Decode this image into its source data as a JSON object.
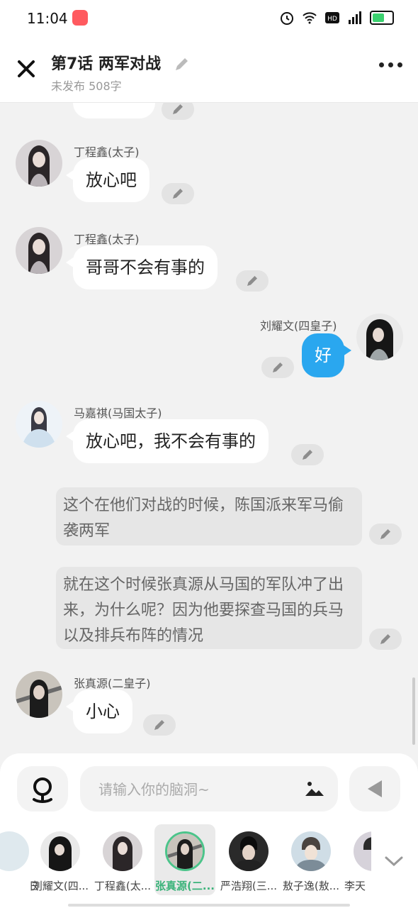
{
  "status_bar": {
    "time": "11:04"
  },
  "header": {
    "title": "第7话  两军对战",
    "subtitle": "未发布 508字"
  },
  "messages": [
    {
      "type": "left",
      "name": "丁程鑫(太子)",
      "text": "放心吧"
    },
    {
      "type": "left",
      "name": "丁程鑫(太子)",
      "text": "哥哥不会有事的"
    },
    {
      "type": "right",
      "name": "刘耀文(四皇子)",
      "text": "好"
    },
    {
      "type": "left",
      "name": "马嘉祺(马国太子)",
      "text": "放心吧，我不会有事的"
    },
    {
      "type": "narration",
      "text": "这个在他们对战的时候，陈国派来军马偷袭两军"
    },
    {
      "type": "narration",
      "text": "就在这个时候张真源从马国的军队冲了出来，为什么呢？因为他要探查马国的兵马以及排兵布阵的情况"
    },
    {
      "type": "left",
      "name": "张真源(二皇子)",
      "text": "小心"
    }
  ],
  "input": {
    "placeholder": "请输入你的脑洞~"
  },
  "roles": [
    {
      "name": "日"
    },
    {
      "name": "刘耀文(四..."
    },
    {
      "name": "丁程鑫(太..."
    },
    {
      "name": "张真源(二...",
      "active": true
    },
    {
      "name": "严浩翔(三..."
    },
    {
      "name": "敖子逸(敖..."
    },
    {
      "name": "李天"
    }
  ],
  "colors": {
    "accent_blue": "#2aa7ef",
    "active_green": "#3bb37a",
    "background": "#f2f2f2"
  }
}
